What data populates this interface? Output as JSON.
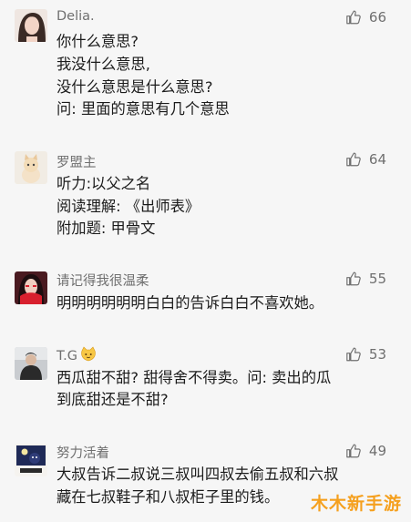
{
  "comments": [
    {
      "username": "Delia.",
      "likes": "66",
      "avatar": "woman-portrait",
      "lines": [
        "你什么意思?",
        "我没什么意思,",
        "没什么意思是什么意思?",
        "问: 里面的意思有几个意思"
      ]
    },
    {
      "username": "罗盟主",
      "likes": "64",
      "avatar": "cat-photo",
      "lines": [
        "听力:以父之名",
        "阅读理解: 《出师表》",
        "附加题: 甲骨文"
      ]
    },
    {
      "username": "请记得我很温柔",
      "likes": "55",
      "avatar": "red-scarf-portrait",
      "lines": [
        "明明明明明明白白的告诉白白不喜欢她。"
      ]
    },
    {
      "username": "T.G",
      "likes": "53",
      "avatar": "man-portrait",
      "username_emoji": "cat-face-emoji",
      "lines": [
        "西瓜甜不甜? 甜得舍不得卖。问: 卖出的瓜",
        "到底甜还是不甜?"
      ]
    },
    {
      "username": "努力活着",
      "likes": "49",
      "avatar": "cartoon-night",
      "lines": [
        "大叔告诉二叔说三叔叫四叔去偷五叔和六叔",
        "藏在七叔鞋子和八叔柜子里的钱。"
      ]
    }
  ],
  "watermark": "木木新手游",
  "colors": {
    "background": "#f6f6f6",
    "meta_text": "#6f6f6f",
    "watermark": "#f5a01e"
  }
}
